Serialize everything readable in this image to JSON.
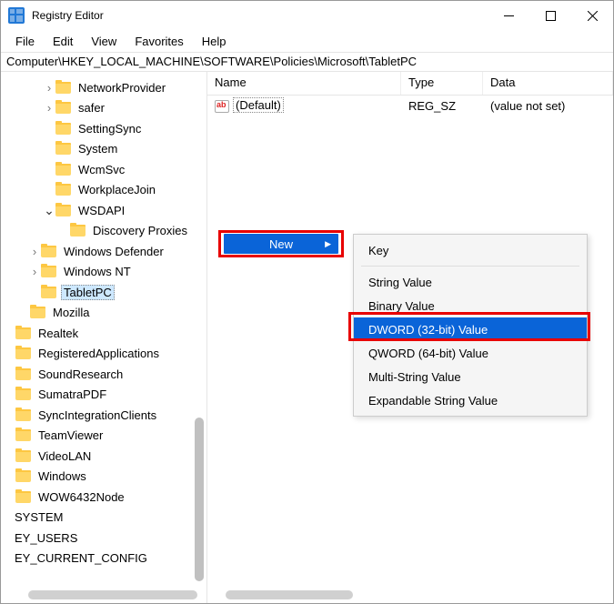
{
  "window": {
    "title": "Registry Editor"
  },
  "menubar": [
    "File",
    "Edit",
    "View",
    "Favorites",
    "Help"
  ],
  "address": "Computer\\HKEY_LOCAL_MACHINE\\SOFTWARE\\Policies\\Microsoft\\TabletPC",
  "tree": [
    {
      "pad": 3,
      "caret": "right",
      "label": "NetworkProvider"
    },
    {
      "pad": 3,
      "caret": "right",
      "label": "safer"
    },
    {
      "pad": 3,
      "caret": "",
      "label": "SettingSync"
    },
    {
      "pad": 3,
      "caret": "",
      "label": "System"
    },
    {
      "pad": 3,
      "caret": "",
      "label": "WcmSvc"
    },
    {
      "pad": 3,
      "caret": "",
      "label": "WorkplaceJoin"
    },
    {
      "pad": 3,
      "caret": "down",
      "label": "WSDAPI"
    },
    {
      "pad": 4,
      "caret": "",
      "label": "Discovery Proxies"
    },
    {
      "pad": 2,
      "caret": "right",
      "label": "Windows Defender"
    },
    {
      "pad": 2,
      "caret": "right",
      "label": "Windows NT"
    },
    {
      "pad": 2,
      "caret": "",
      "label": "TabletPC",
      "selected": true
    },
    {
      "pad": 1,
      "caret": "",
      "label": "Mozilla"
    },
    {
      "pad": 0,
      "caret": "",
      "label": "Realtek"
    },
    {
      "pad": 0,
      "caret": "",
      "label": "RegisteredApplications"
    },
    {
      "pad": 0,
      "caret": "",
      "label": "SoundResearch"
    },
    {
      "pad": 0,
      "caret": "",
      "label": "SumatraPDF"
    },
    {
      "pad": 0,
      "caret": "",
      "label": "SyncIntegrationClients"
    },
    {
      "pad": 0,
      "caret": "",
      "label": "TeamViewer"
    },
    {
      "pad": 0,
      "caret": "",
      "label": "VideoLAN"
    },
    {
      "pad": 0,
      "caret": "",
      "label": "Windows"
    },
    {
      "pad": 0,
      "caret": "",
      "label": "WOW6432Node"
    },
    {
      "pad": 0,
      "caret": "",
      "label": "SYSTEM",
      "nofolder": true,
      "cut": true
    },
    {
      "pad": 0,
      "caret": "",
      "label": "EY_USERS",
      "nofolder": true,
      "cut": true
    },
    {
      "pad": 0,
      "caret": "",
      "label": "EY_CURRENT_CONFIG",
      "nofolder": true,
      "cut": true
    }
  ],
  "list": {
    "headers": {
      "name": "Name",
      "type": "Type",
      "data": "Data"
    },
    "rows": [
      {
        "name": "(Default)",
        "type": "REG_SZ",
        "data": "(value not set)"
      }
    ]
  },
  "context": {
    "new_label": "New",
    "submenu": [
      "Key",
      "---",
      "String Value",
      "Binary Value",
      "DWORD (32-bit) Value",
      "QWORD (64-bit) Value",
      "Multi-String Value",
      "Expandable String Value"
    ],
    "hover_index": 4
  }
}
